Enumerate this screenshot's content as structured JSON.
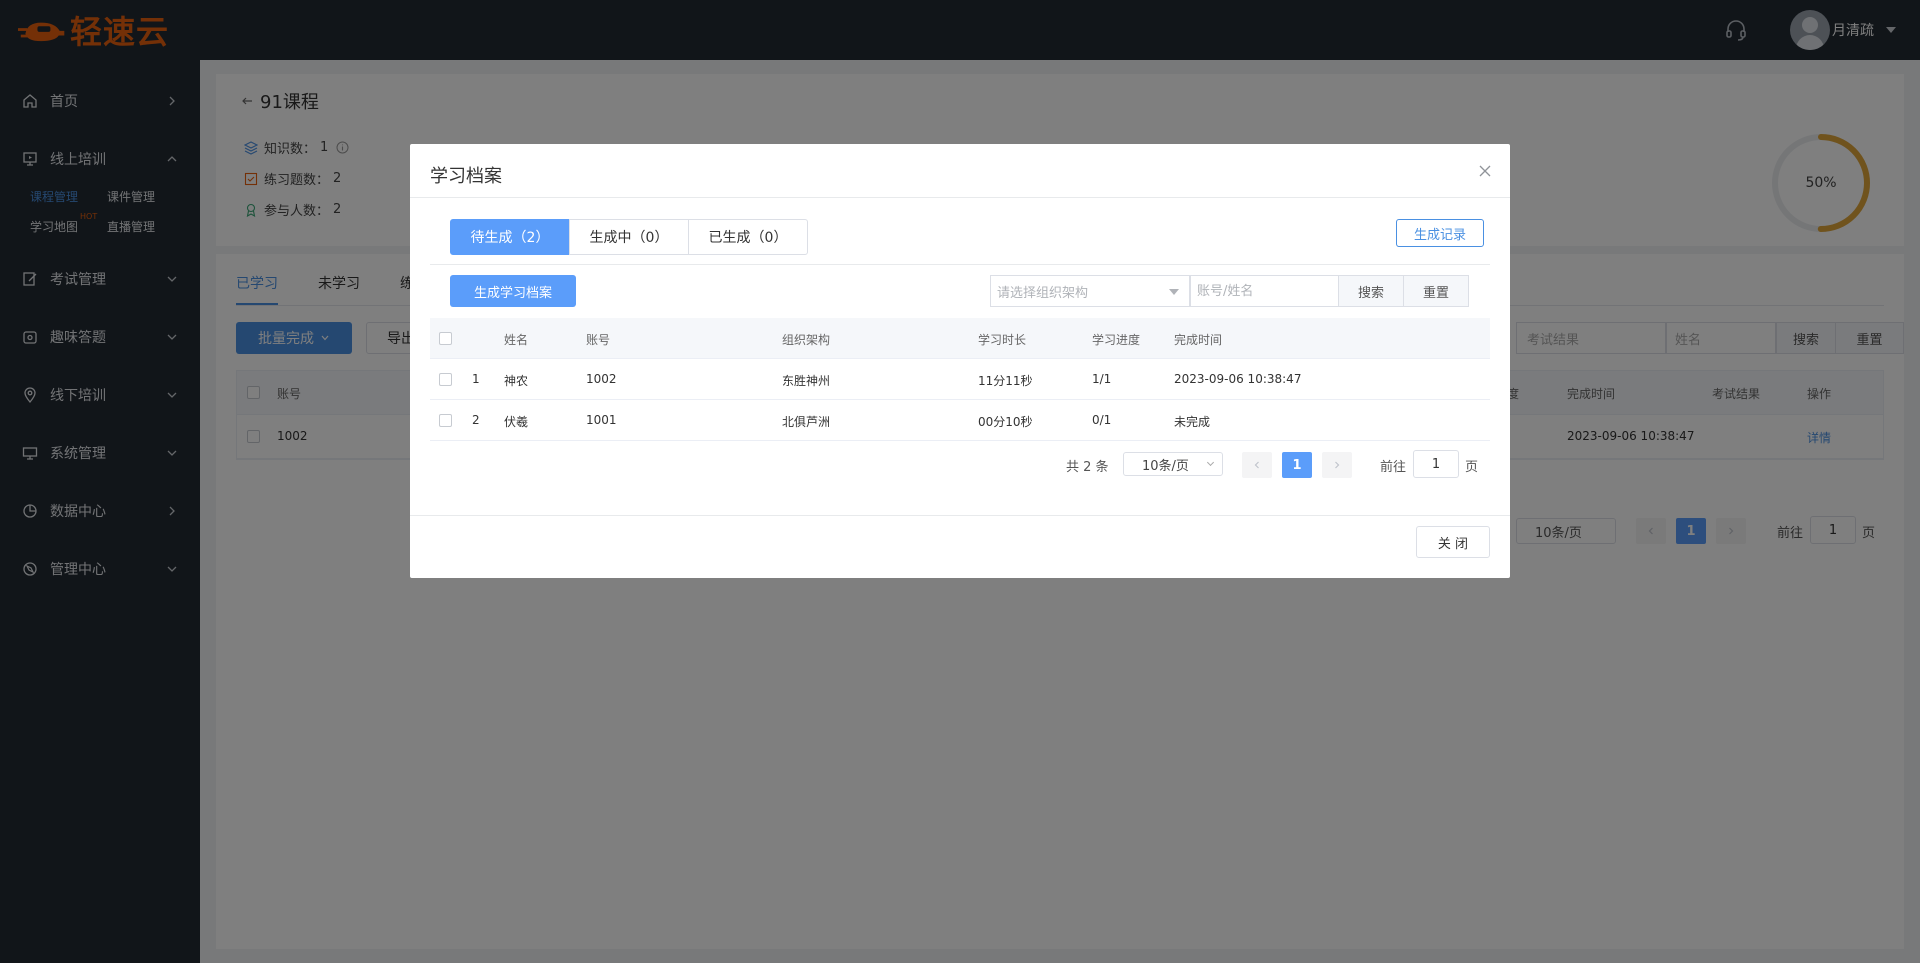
{
  "header": {
    "brand": "轻速云",
    "username": "月清疏"
  },
  "sidebar": {
    "items": [
      {
        "label": "首页",
        "icon": "home-icon"
      },
      {
        "label": "线上培训",
        "icon": "monitor-icon"
      },
      {
        "label": "考试管理",
        "icon": "edit-icon"
      },
      {
        "label": "趣味答题",
        "icon": "game-icon"
      },
      {
        "label": "线下培训",
        "icon": "location-icon"
      },
      {
        "label": "系统管理",
        "icon": "desktop-icon"
      },
      {
        "label": "数据中心",
        "icon": "pie-icon"
      },
      {
        "label": "管理中心",
        "icon": "compass-icon"
      }
    ],
    "submenu": {
      "course_manage": "课程管理",
      "courseware_manage": "课件管理",
      "learning_map": "学习地图",
      "hot_badge": "HOT",
      "live_manage": "直播管理"
    }
  },
  "course": {
    "title": "91课程",
    "knowledge_label": "知识数：",
    "knowledge_value": "1",
    "practice_label": "练习题数：",
    "practice_value": "2",
    "participants_label": "参与人数：",
    "participants_value": "2",
    "progress_percent": "50%",
    "progress_fraction": 0.5
  },
  "background_panel": {
    "tabs": [
      "已学习",
      "未学习",
      "练"
    ],
    "batch_complete": "批量完成",
    "export": "导出",
    "exam_result_placeholder": "考试结果",
    "name_placeholder": "姓名",
    "search": "搜索",
    "reset": "重置",
    "columns": [
      "账号",
      "度",
      "完成时间",
      "考试结果",
      "操作"
    ],
    "row": {
      "account": "1002",
      "finish_time": "2023-09-06 10:38:47",
      "action": "详情"
    },
    "page_size": "10条/页",
    "current_page": "1",
    "goto_label": "前往",
    "goto_value": "1",
    "page_unit": "页"
  },
  "modal": {
    "title": "学习档案",
    "tabs": [
      {
        "label": "待生成（2）",
        "active": true
      },
      {
        "label": "生成中（0）",
        "active": false
      },
      {
        "label": "已生成（0）",
        "active": false
      }
    ],
    "generate_record": "生成记录",
    "generate_button": "生成学习档案",
    "org_placeholder": "请选择组织架构",
    "account_placeholder": "账号/姓名",
    "search": "搜索",
    "reset": "重置",
    "columns": {
      "name": "姓名",
      "account": "账号",
      "org": "组织架构",
      "duration": "学习时长",
      "progress": "学习进度",
      "finish_time": "完成时间"
    },
    "rows": [
      {
        "index": "1",
        "name": "神农",
        "account": "1002",
        "org": "东胜神州",
        "duration": "11分11秒",
        "progress": "1/1",
        "finish_time": "2023-09-06 10:38:47"
      },
      {
        "index": "2",
        "name": "伏羲",
        "account": "1001",
        "org": "北俱芦洲",
        "duration": "00分10秒",
        "progress": "0/1",
        "finish_time": "未完成"
      }
    ],
    "pager": {
      "total": "共 2 条",
      "page_size": "10条/页",
      "current_page": "1",
      "goto_label": "前往",
      "goto_value": "1",
      "page_unit": "页"
    },
    "close": "关 闭"
  },
  "colors": {
    "primary": "#5b9dfa",
    "brand_orange": "#e8600f",
    "sidebar_bg": "#222a33",
    "ring_color": "#e0a63a"
  }
}
